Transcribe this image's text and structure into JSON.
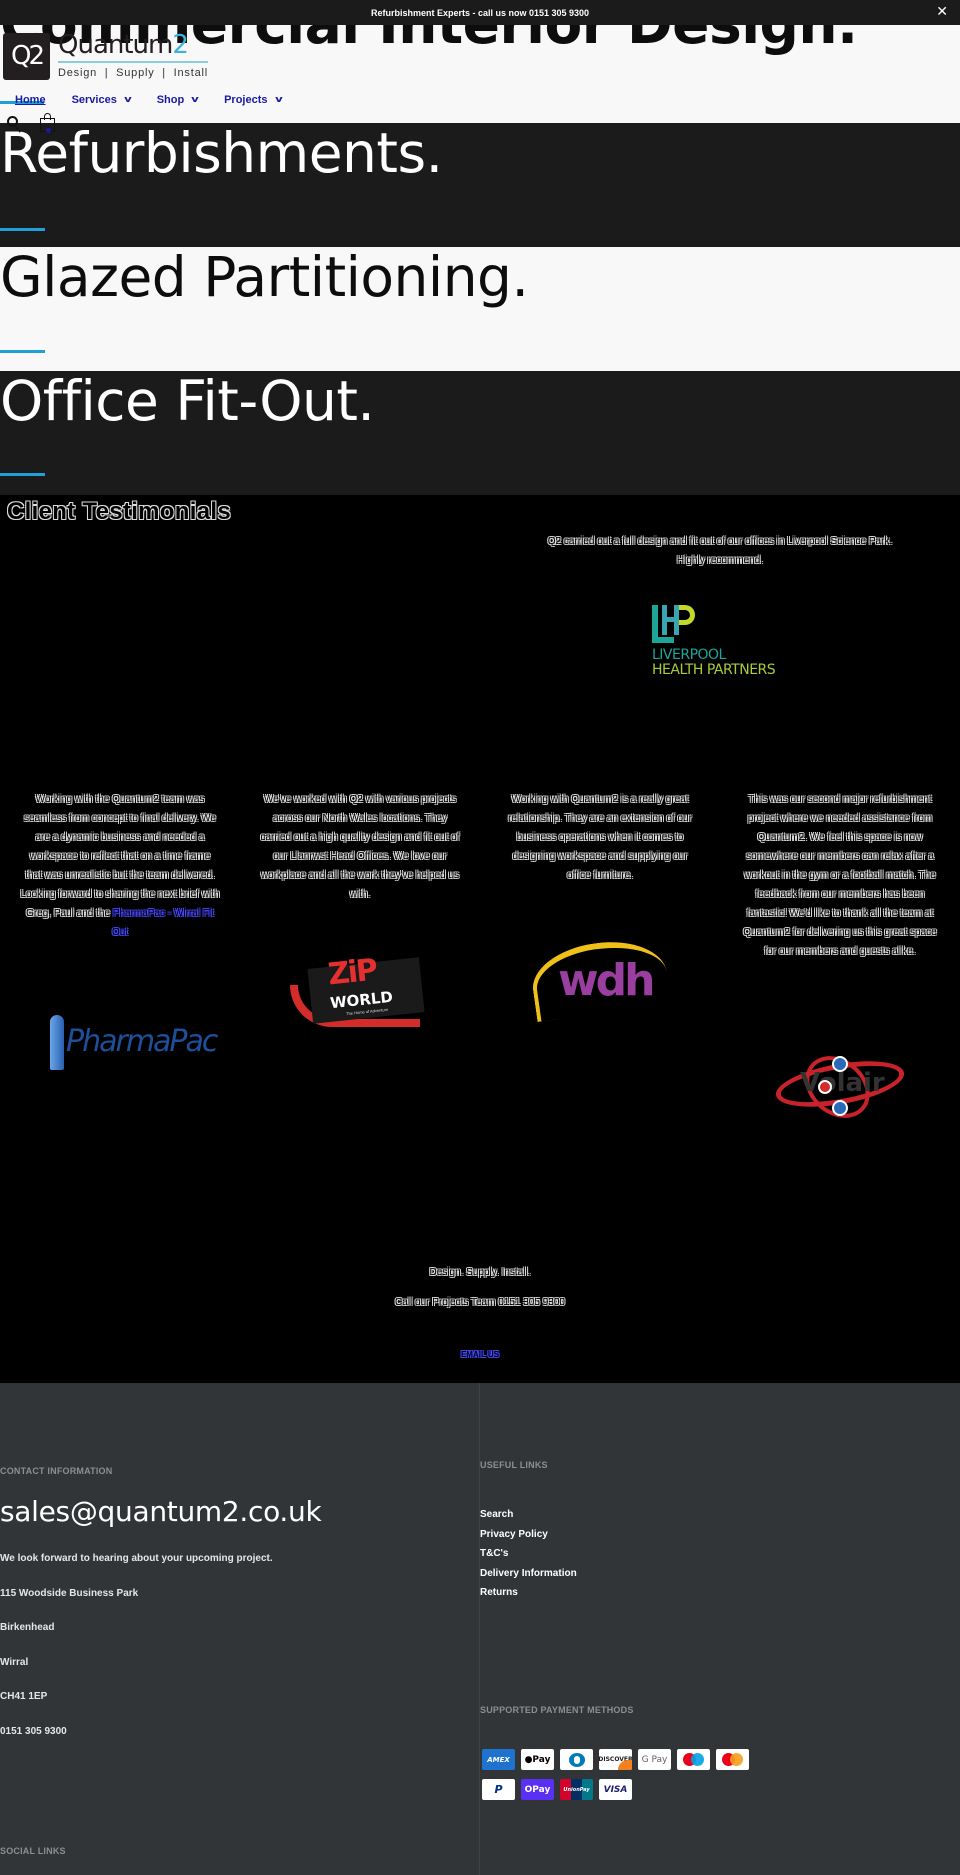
{
  "announcement": {
    "text": "Refurbishment Experts - call us now 0151 305 9300",
    "close_icon": "close-icon"
  },
  "header": {
    "logo_mark": "Q2",
    "logo_name_main": "Quantum",
    "logo_name_accent": "2",
    "logo_tagline": "Design  |  Supply  |  Install",
    "nav": [
      {
        "label": "Home",
        "active": true,
        "has_dropdown": false
      },
      {
        "label": "Services",
        "has_dropdown": true
      },
      {
        "label": "Shop",
        "has_dropdown": true
      },
      {
        "label": "Projects",
        "has_dropdown": true
      }
    ],
    "chevron_glyph": "v",
    "icons": [
      "search-icon",
      "shopping-bag-icon"
    ]
  },
  "hero": {
    "bands": [
      {
        "title": "Commercial Interior Design."
      },
      {
        "title": "Refurbishments."
      },
      {
        "title": "Glazed Partitioning."
      },
      {
        "title": "Office Fit-Out."
      }
    ],
    "accent_color": "#1ea0d6"
  },
  "testimonials": {
    "title": "Client Testimonials",
    "featured": {
      "quote": "Q2 carried out a full design and fit out of our offices in Liverpool Science Park. Highly recommend.",
      "logo": {
        "line1": "LIVERPOOL",
        "line2": "HEALTH PARTNERS"
      }
    },
    "items": [
      {
        "quote": "Working with the Quantum2 team was seamless from concept to final delivery. We are a dynamic business and needed a workspace to reflect that on a time frame that was unrealistic but the team delivered. Looking forward to sharing the next brief with Greg, Paul and the ",
        "link": "PharmaPac - Wirral Fit Out",
        "logo": "PharmaPac"
      },
      {
        "quote": "We've worked with Q2 with various projects across our North Wales locations. They carried out a high quality design and fit out of our Llanrwst Head Offices. We love our workplace and all the work they've helped us with.",
        "logo": {
          "line1": "ZiP",
          "line2": "WORLD",
          "tagline": "The Home of Adventure"
        }
      },
      {
        "quote": "Working with Quantum2 is a really great relationship. They are an extension of our business operations when it comes to designing workspace and supplying our office furniture.",
        "logo": "wdh"
      },
      {
        "quote": "This was our second major refurbishment project where we needed assistance from Quantum2. We feel this space is now somewhere our members can relax after a workout in the gym or a football match. The feedback from our members has been fantastic! We'd like to thank all the team at Quantum2 for delivering us this great space for our members and guests alike.",
        "logo": "Volair"
      }
    ]
  },
  "cta": {
    "tagline": "Design. Supply. Install.",
    "call": "Call our Projects Team 0151 305 9300",
    "email_button": "EMAIL US"
  },
  "footer": {
    "contact_heading": "CONTACT INFORMATION",
    "email": "sales@quantum2.co.uk",
    "intro": "We look forward to hearing about your upcoming project.",
    "address": [
      "115 Woodside Business Park",
      "Birkenhead",
      "Wirral",
      "CH41 1EP",
      "0151 305 9300"
    ],
    "social_heading": "SOCIAL LINKS",
    "links_heading": "USEFUL LINKS",
    "links": [
      "Search",
      "Privacy Policy",
      "T&C's",
      "Delivery Information",
      "Returns"
    ],
    "payments_heading": "SUPPORTED PAYMENT METHODS",
    "payments": {
      "amex": "AMEX",
      "apple_pay": "Pay",
      "diners": "Diners Club",
      "discover": "DISCOVER",
      "google_pay": "G Pay",
      "maestro": "Maestro",
      "mastercard": "Mastercard",
      "paypal": "P",
      "shop_pay": "OPay",
      "unionpay": "UnionPay",
      "visa": "VISA"
    }
  }
}
